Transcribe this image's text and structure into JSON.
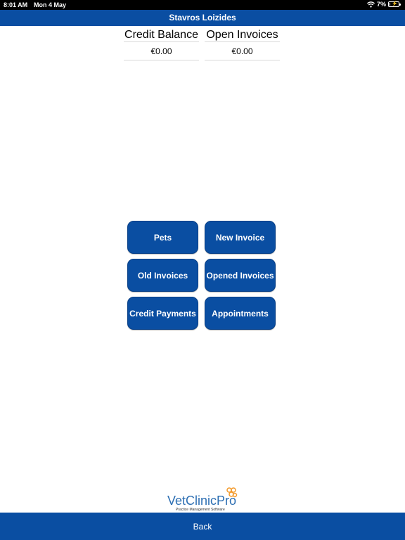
{
  "status_bar": {
    "time": "8:01 AM",
    "date": "Mon 4 May",
    "battery": "7%"
  },
  "header": {
    "title": "Stavros Loizides"
  },
  "summary": {
    "credit_balance_label": "Credit Balance",
    "credit_balance_value": "€0.00",
    "open_invoices_label": "Open Invoices",
    "open_invoices_value": "€0.00"
  },
  "menu": {
    "pets": "Pets",
    "new_invoice": "New Invoice",
    "old_invoices": "Old Invoices",
    "opened_invoices": "Opened Invoices",
    "credit_payments": "Credit Payments",
    "appointments": "Appointments"
  },
  "logo": {
    "name": "VetClinicPro",
    "tagline": "Practice Management Software"
  },
  "footer": {
    "back_label": "Back"
  },
  "colors": {
    "primary": "#0a4ea2",
    "status_bar": "#000000",
    "logo_orange": "#f39a2b"
  }
}
